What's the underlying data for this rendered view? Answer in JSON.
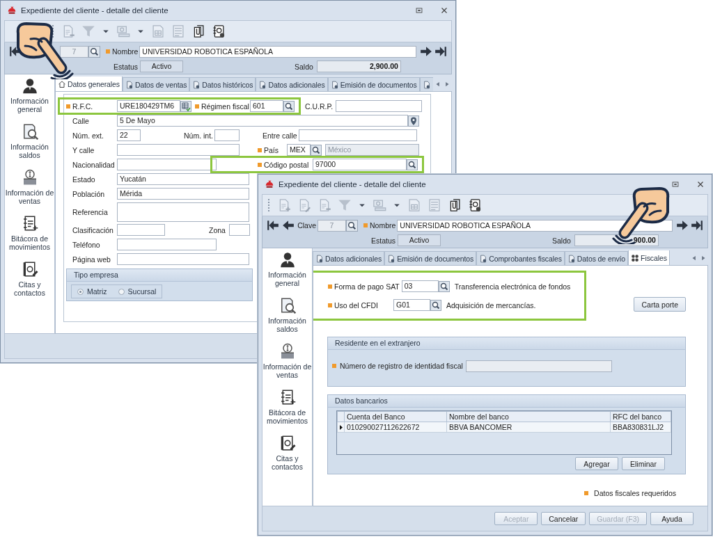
{
  "back": {
    "title": "Expediente del cliente - detalle del cliente",
    "toolbar": [
      {
        "kind": "doc-remove",
        "disabled": true
      },
      {
        "kind": "filter",
        "disabled": true
      },
      {
        "kind": "caret",
        "disabled": false
      },
      {
        "kind": "cash",
        "disabled": true
      },
      {
        "kind": "caret",
        "disabled": false
      },
      {
        "kind": "doc-table",
        "disabled": true
      },
      {
        "kind": "list",
        "disabled": true
      },
      {
        "kind": "clip",
        "disabled": false
      },
      {
        "kind": "contact",
        "disabled": false
      }
    ],
    "record": {
      "clave": "7",
      "nombre_label": "Nombre",
      "nombre": "UNIVERSIDAD ROBOTICA ESPAÑOLA",
      "nombre_required": true,
      "estatus_label": "Estatus",
      "estatus": "Activo",
      "saldo_label": "Saldo",
      "saldo": "2,900.00"
    },
    "sidebar": [
      {
        "kind": "user",
        "label": "Información general"
      },
      {
        "kind": "balance",
        "label": "Información saldos"
      },
      {
        "kind": "coins",
        "label": "Información de ventas"
      },
      {
        "kind": "log",
        "label": "Bitácora de movimientos"
      },
      {
        "kind": "contacts",
        "label": "Citas y contactos"
      }
    ],
    "tabs": [
      {
        "kind": "home",
        "label": "Datos generales",
        "selected": true
      },
      {
        "kind": "document",
        "label": "Datos de ventas",
        "selected": false
      },
      {
        "kind": "document",
        "label": "Datos históricos",
        "selected": false
      },
      {
        "kind": "document",
        "label": "Datos adicionales",
        "selected": false
      },
      {
        "kind": "document",
        "label": "Emisión de documentos",
        "selected": false
      },
      {
        "kind": "document",
        "selected": false
      }
    ],
    "form": {
      "rows": [
        [
          {
            "kind": "lookup",
            "label": "R.F.C.",
            "value": "URE180429TM6",
            "required": true,
            "highlighted": true
          },
          {
            "kind": "search",
            "label": "Régimen fiscal",
            "value": "601",
            "required": true,
            "highlighted": true
          },
          {
            "kind": "text",
            "label": "C.U.R.P.",
            "required": false,
            "highlighted": false
          }
        ],
        [
          {
            "kind": "pin",
            "label": "Calle",
            "value": "5 De Mayo",
            "required": false,
            "highlighted": false
          }
        ],
        [
          {
            "kind": "text",
            "label": "Núm. ext.",
            "value": "22",
            "required": false,
            "highlighted": false
          },
          {
            "kind": "text",
            "label": "Núm. int.",
            "required": false,
            "highlighted": false
          },
          {
            "kind": "text",
            "label": "Entre calle",
            "required": false,
            "highlighted": false
          }
        ],
        [
          {
            "kind": "text",
            "label": "Y calle",
            "required": false,
            "highlighted": false
          },
          {
            "kind": "search",
            "label": "País",
            "value": "MEX",
            "required": true,
            "highlighted": false,
            "secondary": "México"
          }
        ],
        [
          {
            "kind": "text",
            "label": "Nacionalidad",
            "required": false,
            "highlighted": false
          },
          {
            "kind": "search",
            "label": "Código postal",
            "value": "97000",
            "required": true,
            "highlighted": true
          }
        ],
        [
          {
            "kind": "text",
            "label": "Estado",
            "value": "Yucatán",
            "required": false,
            "highlighted": false
          }
        ],
        [
          {
            "kind": "text",
            "label": "Población",
            "value": "Mérida",
            "required": false,
            "highlighted": false
          }
        ],
        [
          {
            "kind": "multiline",
            "label": "Referencia",
            "required": false,
            "highlighted": false
          }
        ],
        [
          {
            "kind": "text",
            "label": "Clasificación",
            "required": false,
            "highlighted": false
          },
          {
            "kind": "text",
            "label": "Zona",
            "required": false,
            "highlighted": false
          }
        ],
        [
          {
            "kind": "text",
            "label": "Teléfono",
            "required": false,
            "highlighted": false
          }
        ],
        [
          {
            "kind": "text",
            "label": "Página web",
            "required": false,
            "highlighted": false
          }
        ]
      ],
      "group": {
        "title": "Tipo empresa",
        "options": [
          {
            "label": "Matriz",
            "selected": true
          },
          {
            "label": "Sucursal",
            "selected": false
          }
        ]
      }
    }
  },
  "front": {
    "title": "Expediente del cliente - detalle del cliente",
    "toolbar": [
      {
        "kind": "doc-add",
        "disabled": true
      },
      {
        "kind": "doc-edit",
        "disabled": true
      },
      {
        "kind": "doc-remove",
        "disabled": true
      },
      {
        "kind": "filter",
        "disabled": true
      },
      {
        "kind": "caret",
        "disabled": false
      },
      {
        "kind": "cash",
        "disabled": true
      },
      {
        "kind": "caret",
        "disabled": false
      },
      {
        "kind": "doc-table",
        "disabled": true
      },
      {
        "kind": "list",
        "disabled": true
      },
      {
        "kind": "clip",
        "disabled": false
      },
      {
        "kind": "contact",
        "disabled": false
      }
    ],
    "record": {
      "clave_label": "Clave",
      "clave": "7",
      "nombre_label": "Nombre",
      "nombre": "UNIVERSIDAD ROBOTICA ESPAÑOLA",
      "nombre_required": true,
      "estatus_label": "Estatus",
      "estatus": "Activo",
      "saldo_label": "Saldo",
      "saldo": "900.00"
    },
    "sidebar": [
      {
        "kind": "user",
        "label": "Información general"
      },
      {
        "kind": "balance",
        "label": "Información saldos"
      },
      {
        "kind": "coins",
        "label": "Información de ventas"
      },
      {
        "kind": "log",
        "label": "Bitácora de movimientos"
      },
      {
        "kind": "contacts",
        "label": "Citas y contactos"
      }
    ],
    "tabs": [
      {
        "kind": "document",
        "label": "Datos adicionales",
        "selected": false
      },
      {
        "kind": "document",
        "label": "Emisión de documentos",
        "selected": false
      },
      {
        "kind": "document",
        "label": "Comprobantes fiscales",
        "selected": false
      },
      {
        "kind": "document",
        "label": "Datos de envío",
        "selected": false
      },
      {
        "kind": "fiscal",
        "label": "Fiscales",
        "selected": true
      }
    ],
    "fiscal": {
      "rows": [
        {
          "label": "Forma de pago SAT",
          "value": "03",
          "description": "Transferencia electrónica de fondos",
          "required": true,
          "highlighted": true
        },
        {
          "label": "Uso del CFDI",
          "value": "G01",
          "description": "Adquisición de mercancías.",
          "required": true,
          "highlighted": true
        }
      ],
      "carta_porte": "Carta porte",
      "resident": {
        "title": "Residente en el extranjero",
        "label": "Número de registro de identidad fiscal",
        "required": true,
        "disabled": true
      },
      "bank": {
        "title": "Datos bancarios",
        "columns": [
          "Cuenta del Banco",
          "Nombre del banco",
          "RFC del banco"
        ],
        "rows": [
          {
            "cells": [
              "010290027112622672",
              "BBVA BANCOMER",
              "BBA830831LJ2"
            ],
            "selected": true
          }
        ],
        "buttons": [
          "Agregar",
          "Eliminar"
        ]
      },
      "legend": "Datos fiscales requeridos"
    },
    "footer": [
      {
        "label": "Aceptar",
        "disabled": true
      },
      {
        "label": "Cancelar",
        "disabled": false
      },
      {
        "label": "Guardar (F3)",
        "disabled": true
      },
      {
        "label": "Ayuda",
        "disabled": false
      }
    ]
  }
}
